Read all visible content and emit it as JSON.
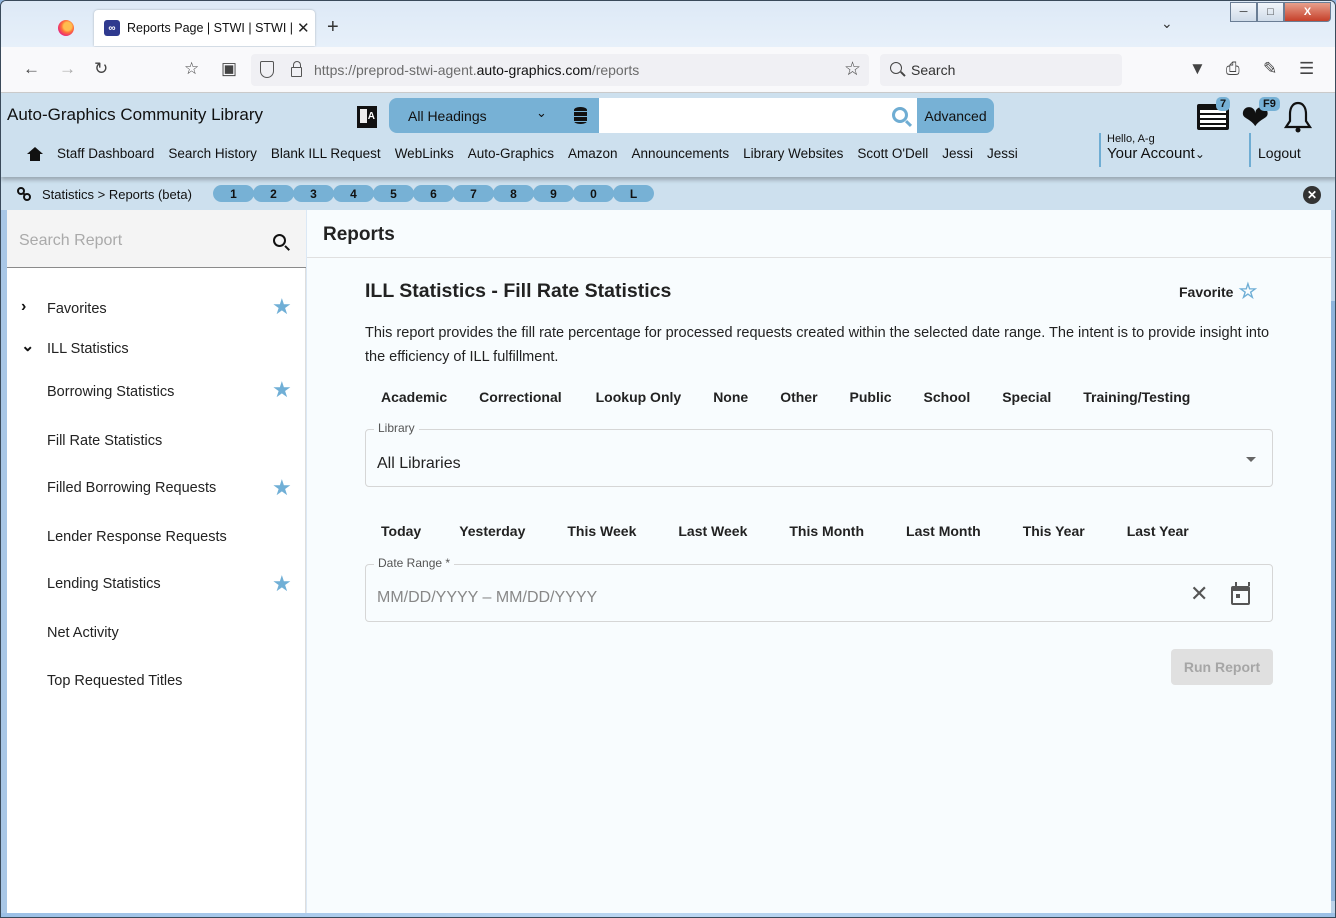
{
  "browser": {
    "tab_title": "Reports Page | STWI | STWI | Auto-Graphics",
    "tab_favicon": "ag-logo",
    "url_prefix": "https://preprod-stwi-agent.",
    "url_domain": "auto-graphics.com",
    "url_path": "/reports",
    "search_placeholder": "Search",
    "icons": [
      "back-arrow",
      "forward-arrow",
      "reload",
      "bookmark-star-tray",
      "share",
      "shield",
      "lock",
      "bookmark-star",
      "pocket",
      "print",
      "extensions",
      "menu"
    ]
  },
  "header": {
    "library_name": "Auto-Graphics Community Library",
    "search_scope": "All Headings",
    "search_value": "",
    "advanced_label": "Advanced",
    "list_badge": "7",
    "favorites_badge": "F9",
    "hello_text": "Hello, A-g",
    "account_label": "Your Account",
    "logout_label": "Logout",
    "nav_links": [
      "Staff Dashboard",
      "Search History",
      "Blank ILL Request",
      "WebLinks",
      "Auto-Graphics",
      "Amazon",
      "Announcements",
      "Library Websites",
      "Scott O'Dell",
      "Jessi",
      "Jessi"
    ]
  },
  "breadcrumb": {
    "text": "Statistics > Reports (beta)",
    "quick_keys": [
      "1",
      "2",
      "3",
      "4",
      "5",
      "6",
      "7",
      "8",
      "9",
      "0",
      "L"
    ]
  },
  "sidebar": {
    "search_placeholder": "Search Report",
    "groups": [
      {
        "label": "Favorites",
        "expanded": false,
        "favorite": true
      },
      {
        "label": "ILL Statistics",
        "expanded": true,
        "favorite": false
      }
    ],
    "items": [
      {
        "label": "Borrowing Statistics",
        "favorite": true
      },
      {
        "label": "Fill Rate Statistics",
        "favorite": false
      },
      {
        "label": "Filled Borrowing Requests",
        "favorite": true
      },
      {
        "label": "Lender Response Requests",
        "favorite": false
      },
      {
        "label": "Lending Statistics",
        "favorite": true
      },
      {
        "label": "Net Activity",
        "favorite": false
      },
      {
        "label": "Top Requested Titles",
        "favorite": false
      }
    ]
  },
  "main": {
    "title": "Reports",
    "report_title": "ILL Statistics - Fill Rate Statistics",
    "favorite_label": "Favorite",
    "description": "This report provides the fill rate percentage for processed requests created within the selected date range. The intent is to provide insight into the efficiency of ILL fulfillment.",
    "library_types": [
      "Academic",
      "Correctional",
      "Lookup Only",
      "None",
      "Other",
      "Public",
      "School",
      "Special",
      "Training/Testing"
    ],
    "library_field": {
      "label": "Library",
      "value": "All Libraries"
    },
    "date_presets": [
      "Today",
      "Yesterday",
      "This Week",
      "Last Week",
      "This Month",
      "Last Month",
      "This Year",
      "Last Year"
    ],
    "date_field": {
      "label": "Date Range *",
      "placeholder": "MM/DD/YYYY – MM/DD/YYYY"
    },
    "run_label": "Run Report"
  }
}
